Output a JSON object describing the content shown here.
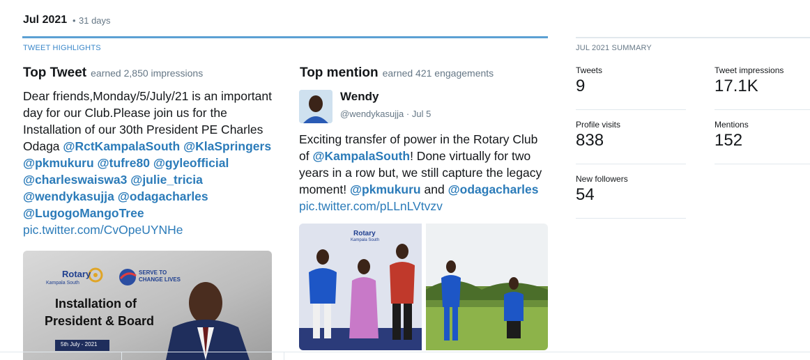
{
  "header": {
    "month": "Jul 2021",
    "separator": "•",
    "days": "31 days"
  },
  "highlights": {
    "label": "TWEET HIGHLIGHTS"
  },
  "top_tweet": {
    "title": "Top Tweet",
    "subtitle": "earned 2,850 impressions",
    "text_plain": "Dear friends,Monday/5/July/21 is an important day for our Club.Please join us for the Installation of our 30th President PE Charles Odaga",
    "mentions": [
      "@RctKampalaSouth",
      "@KlaSpringers",
      "@pkmukuru",
      "@tufre80",
      "@gyleofficial",
      "@charleswaiswa3",
      "@julie_tricia",
      "@wendykasujja",
      "@odagacharles",
      "@LugogoMangoTree"
    ],
    "pic_link": "pic.twitter.com/CvOpeUYNHe",
    "image": {
      "logo": "Rotary",
      "logo_sub": "Kampala South",
      "slogan_1": "SERVE TO",
      "slogan_2": "CHANGE LIVES",
      "heading_1": "Installation of",
      "heading_2": "President & Board",
      "date": "5th July - 2021"
    }
  },
  "top_mention": {
    "title": "Top mention",
    "subtitle": "earned 421 engagements",
    "author_name": "Wendy",
    "author_handle": "@wendykasujja",
    "dot": "·",
    "date": "Jul 5",
    "text_1": "Exciting transfer of power in the Rotary Club of",
    "mention_1": "@KampalaSouth",
    "text_2": "! Done virtually for two years in a row but, we still capture the legacy moment!",
    "mention_2": "@pkmukuru",
    "text_3": "and",
    "mention_3": "@odagacharles",
    "pic_link": "pic.twitter.com/pLLnLVtvzv",
    "banner_text": "Rotary",
    "banner_sub": "Kampala South"
  },
  "summary": {
    "label": "JUL 2021 SUMMARY",
    "stats": [
      {
        "label": "Tweets",
        "value": "9"
      },
      {
        "label": "Tweet impressions",
        "value": "17.1K"
      },
      {
        "label": "Profile visits",
        "value": "838"
      },
      {
        "label": "Mentions",
        "value": "152"
      },
      {
        "label": "New followers",
        "value": "54"
      }
    ]
  },
  "colors": {
    "accent_blue": "#5ca0d3",
    "link_blue": "#2b7bb9",
    "muted": "#657786",
    "text": "#14171a"
  }
}
